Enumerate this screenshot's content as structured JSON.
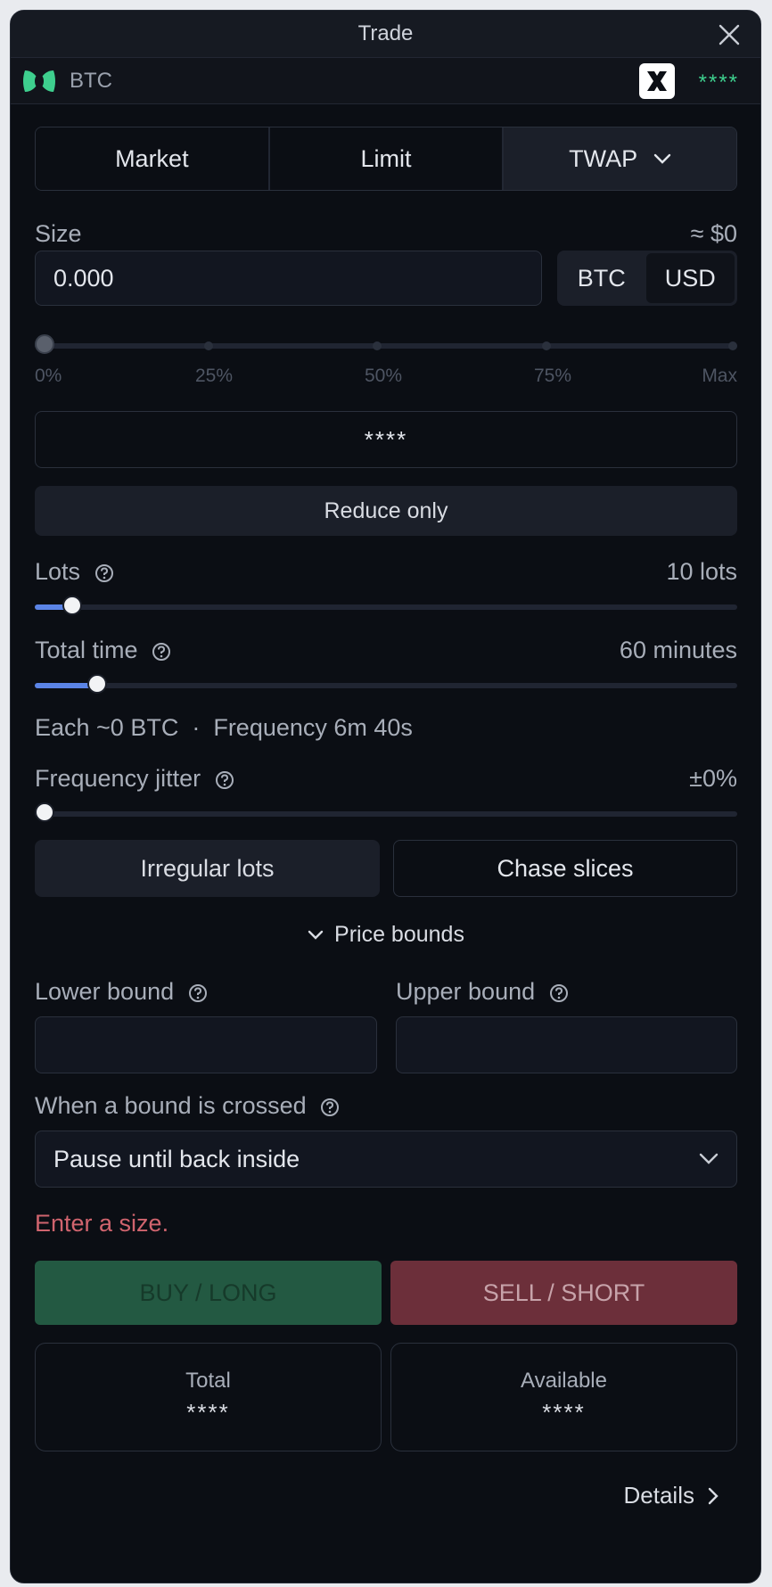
{
  "window": {
    "title": "Trade"
  },
  "asset": {
    "symbol": "BTC",
    "account_masked": "****",
    "accent_color": "#3ecf8e"
  },
  "order_types": {
    "market": "Market",
    "limit": "Limit",
    "twap": "TWAP"
  },
  "size": {
    "label": "Size",
    "usd_estimate": "≈ $0",
    "value": "0.000",
    "units": [
      "BTC",
      "USD"
    ],
    "selected_unit": "USD",
    "slider_percent": 0,
    "slider_marks": [
      "0%",
      "25%",
      "50%",
      "75%",
      "Max"
    ]
  },
  "masked_field": "****",
  "reduce_only": "Reduce only",
  "lots": {
    "label": "Lots",
    "value": "10 lots",
    "slider_fraction": 0.055
  },
  "total_time": {
    "label": "Total time",
    "value": "60 minutes",
    "slider_fraction": 0.09
  },
  "each_line": "Each ~0 BTC  ·  Frequency 6m 40s",
  "frequency_jitter": {
    "label": "Frequency jitter",
    "value": "±0%",
    "slider_fraction": 0
  },
  "options": {
    "irregular_lots": "Irregular lots",
    "chase_slices": "Chase slices"
  },
  "price_bounds": {
    "toggle_label": "Price bounds",
    "lower_label": "Lower bound",
    "upper_label": "Upper bound",
    "lower_value": "",
    "upper_value": "",
    "crossed_label": "When a bound is crossed",
    "crossed_value": "Pause until back inside"
  },
  "error_message": "Enter a size.",
  "error_color": "#d0646e",
  "actions": {
    "buy": "BUY / LONG",
    "sell": "SELL / SHORT"
  },
  "stats": {
    "total_label": "Total",
    "total_value": "****",
    "available_label": "Available",
    "available_value": "****"
  },
  "details_label": "Details",
  "icons": [
    "close-icon",
    "asset-logo-icon",
    "account-logo-icon",
    "chevron-down-icon",
    "help-icon",
    "chevron-right-icon"
  ]
}
